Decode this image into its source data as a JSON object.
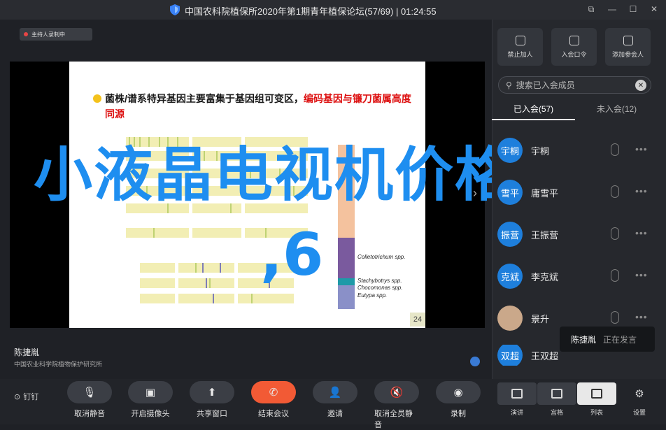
{
  "window": {
    "title": "中国农科院植保所2020年第1期青年植保论坛(57/69) | 01:24:55"
  },
  "recording_badge": "主持人录制中",
  "slide": {
    "title_black": "菌株/谱系特异基因主要富集于基因组可变区，",
    "title_red": "编码基因与镰刀菌属高度同源",
    "page_number": "24",
    "legend": [
      "Colletotrichum spp.",
      "Stachybotrys spp.",
      "Chocomonas spp.",
      "Eutypa spp."
    ]
  },
  "overlay_text": {
    "line1": "小液晶电视机价格",
    "line2": ",6"
  },
  "speaker": {
    "name": "陈捷胤",
    "org": "中国农业科学院植物保护研究所"
  },
  "right_panel": {
    "buttons": [
      {
        "label": "禁止加人",
        "icon": "lock-icon"
      },
      {
        "label": "入会口令",
        "icon": "link-icon"
      },
      {
        "label": "添加参会人",
        "icon": "add-user-icon"
      }
    ],
    "search_placeholder": "搜索已入会成员",
    "tabs": [
      {
        "label": "已入会(57)"
      },
      {
        "label": "未入会(12)"
      }
    ],
    "members": [
      {
        "avatar": "宇桐",
        "name": "宇桐"
      },
      {
        "avatar": "雪平",
        "name": "庸雪平"
      },
      {
        "avatar": "振营",
        "name": "王振营"
      },
      {
        "avatar": "克斌",
        "name": "李克斌"
      },
      {
        "avatar": "",
        "name": "景升"
      },
      {
        "avatar": "双超",
        "name": "王双超"
      }
    ],
    "tooltip": {
      "name": "陈捷胤",
      "status": "正在发言"
    }
  },
  "toolbar": {
    "pin": "钉钉",
    "controls": [
      {
        "label": "取消静音",
        "icon": "mic-icon",
        "glyph": "🎙"
      },
      {
        "label": "开启摄像头",
        "icon": "camera-icon",
        "glyph": "▣"
      },
      {
        "label": "共享窗口",
        "icon": "share-icon",
        "glyph": "⬆"
      },
      {
        "label": "结束会议",
        "icon": "hangup-icon",
        "glyph": "✆"
      },
      {
        "label": "邀请",
        "icon": "invite-icon",
        "glyph": "👤"
      },
      {
        "label": "取消全员静音",
        "icon": "mute-all-icon",
        "glyph": "🔇"
      },
      {
        "label": "录制",
        "icon": "record-icon",
        "glyph": "◉"
      }
    ],
    "views": [
      {
        "label": "演讲"
      },
      {
        "label": "宫格"
      },
      {
        "label": "列表"
      },
      {
        "label": "设置"
      }
    ]
  }
}
